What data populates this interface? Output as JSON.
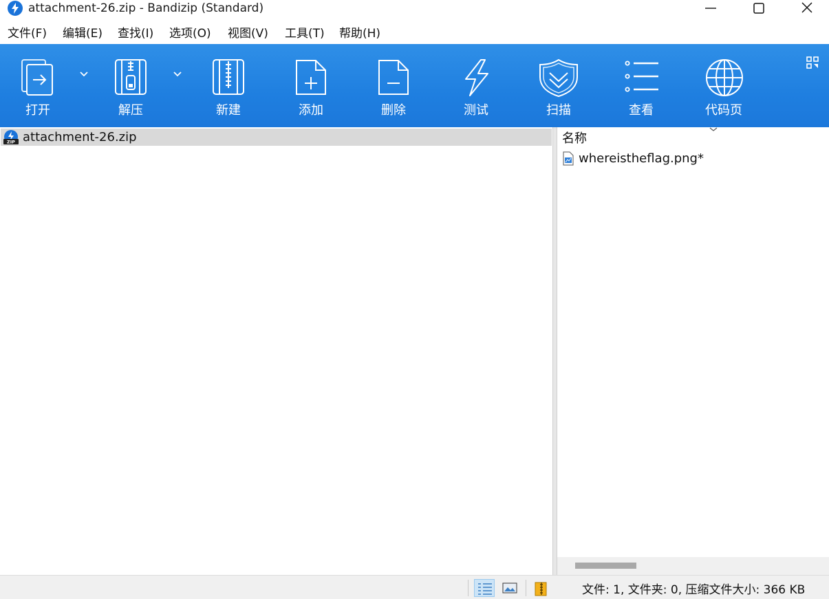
{
  "window": {
    "title": "attachment-26.zip - Bandizip (Standard)",
    "controls": {
      "minimize": "minimize-icon",
      "maximize": "maximize-icon",
      "close": "close-icon"
    }
  },
  "menu": {
    "items": [
      "文件(F)",
      "编辑(E)",
      "查找(I)",
      "选项(O)",
      "视图(V)",
      "工具(T)",
      "帮助(H)"
    ]
  },
  "toolbar": {
    "background": "#1f7fe0",
    "buttons": [
      {
        "label": "打开",
        "icon": "open-icon",
        "has_dropdown": true
      },
      {
        "label": "解压",
        "icon": "extract-icon",
        "has_dropdown": true
      },
      {
        "label": "新建",
        "icon": "new-archive-icon",
        "has_dropdown": false
      },
      {
        "label": "添加",
        "icon": "add-icon",
        "has_dropdown": false
      },
      {
        "label": "删除",
        "icon": "delete-icon",
        "has_dropdown": false
      },
      {
        "label": "测试",
        "icon": "test-icon",
        "has_dropdown": false
      },
      {
        "label": "扫描",
        "icon": "scan-shield-icon",
        "has_dropdown": false
      },
      {
        "label": "查看",
        "icon": "view-list-icon",
        "has_dropdown": false
      },
      {
        "label": "代码页",
        "icon": "globe-icon",
        "has_dropdown": false
      }
    ],
    "layout_switch_icon": "layout-grid-icon"
  },
  "tree": {
    "selected": "attachment-26.zip",
    "items": [
      {
        "name": "attachment-26.zip",
        "icon": "zip-archive-icon"
      }
    ]
  },
  "file_list": {
    "column_name": "名称",
    "files": [
      {
        "name": "whereistheflag.png*",
        "icon": "image-file-icon"
      }
    ]
  },
  "status": {
    "text": "文件: 1, 文件夹: 0, 压缩文件大小: 366 KB",
    "view_buttons": [
      "details-view-icon",
      "preview-view-icon",
      "archive-info-icon"
    ]
  }
}
